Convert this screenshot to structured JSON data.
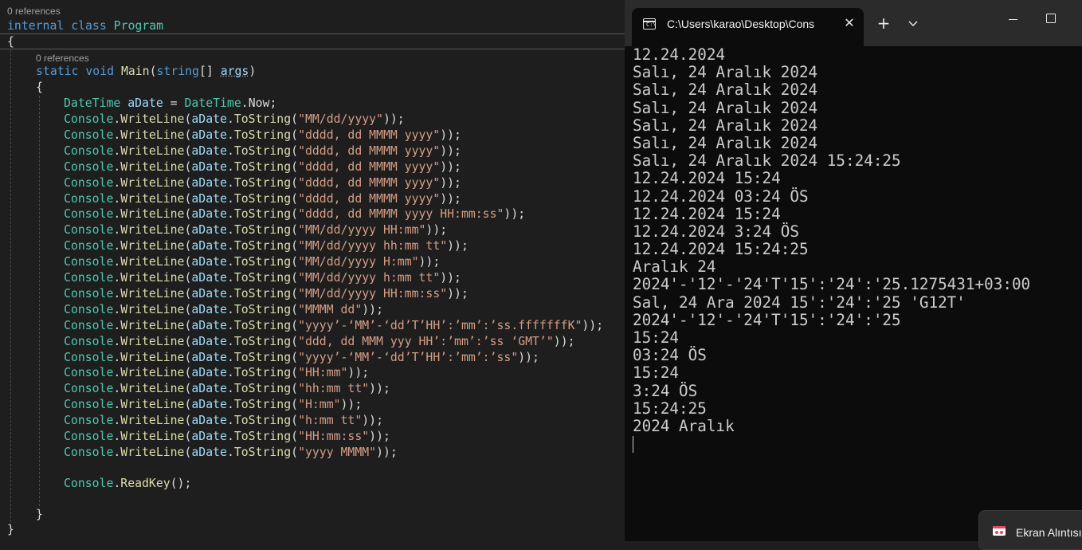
{
  "editor": {
    "class_refs": "0 references",
    "method_refs": "0 references",
    "class_decl": {
      "kw1": "internal",
      "kw2": "class",
      "name": "Program"
    },
    "open_brace": "{",
    "close_brace": "}",
    "main_sig": {
      "kw1": "static",
      "kw2": "void",
      "name": "Main",
      "p1": "(",
      "ptype": "string",
      "p2": "[] ",
      "param": "args",
      "p3": ")"
    },
    "method_open": "{",
    "method_close": "}",
    "decl_line": {
      "type": "DateTime",
      "var": "aDate",
      "eq": " = ",
      "type2": "DateTime",
      "dot": ".",
      "prop": "Now",
      "semi": ";"
    },
    "write_prefix": {
      "cls": "Console",
      "dot1": ".",
      "method": "WriteLine",
      "op1": "(",
      "var": "aDate",
      "dot2": ".",
      "method2": "ToString",
      "op2": "("
    },
    "write_suffix": "));",
    "format_strings": [
      "\"MM/dd/yyyy\"",
      "\"dddd, dd MMMM yyyy\"",
      "\"dddd, dd MMMM yyyy\"",
      "\"dddd, dd MMMM yyyy\"",
      "\"dddd, dd MMMM yyyy\"",
      "\"dddd, dd MMMM yyyy\"",
      "\"dddd, dd MMMM yyyy HH:mm:ss\"",
      "\"MM/dd/yyyy HH:mm\"",
      "\"MM/dd/yyyy hh:mm tt\"",
      "\"MM/dd/yyyy H:mm\"",
      "\"MM/dd/yyyy h:mm tt\"",
      "\"MM/dd/yyyy HH:mm:ss\"",
      "\"MMMM dd\"",
      "\"yyyy’-‘MM’-‘dd’T’HH’:’mm’:’ss.fffffffK\"",
      "\"ddd, dd MMM yyy HH’:’mm’:’ss ‘GMT’\"",
      "\"yyyy’-‘MM’-‘dd’T’HH’:’mm’:’ss\"",
      "\"HH:mm\"",
      "\"hh:mm tt\"",
      "\"H:mm\"",
      "\"h:mm tt\"",
      "\"HH:mm:ss\"",
      "\"yyyy MMMM\""
    ],
    "readkey_line": {
      "cls": "Console",
      "dot": ".",
      "method": "ReadKey",
      "rest": "();"
    }
  },
  "terminal": {
    "tab_title": "C:\\Users\\karao\\Desktop\\Cons",
    "tab_icon_glyph": "C:\\",
    "close_glyph": "✕",
    "new_tab_glyph": "+",
    "output": [
      "12.24.2024",
      "Salı, 24 Aralık 2024",
      "Salı, 24 Aralık 2024",
      "Salı, 24 Aralık 2024",
      "Salı, 24 Aralık 2024",
      "Salı, 24 Aralık 2024",
      "Salı, 24 Aralık 2024 15:24:25",
      "12.24.2024 15:24",
      "12.24.2024 03:24 ÖS",
      "12.24.2024 15:24",
      "12.24.2024 3:24 ÖS",
      "12.24.2024 15:24:25",
      "Aralık 24",
      "2024'-'12'-'24'T'15':'24':'25.1275431+03:00",
      "Sal, 24 Ara 2024 15':'24':'25 'G12T'",
      "2024'-'12'-'24'T'15':'24':'25",
      "15:24",
      "03:24 ÖS",
      "15:24",
      "3:24 ÖS",
      "15:24:25",
      "2024 Aralık"
    ]
  },
  "toast": {
    "label": "Ekran Alıntısı"
  },
  "colors": {
    "keyword": "#569cd6",
    "type": "#4ec9b0",
    "method": "#dcdcaa",
    "variable": "#9cdcfe",
    "string": "#d69d85",
    "editor_bg": "#1e1e1e",
    "terminal_bg": "#0c0c0c"
  }
}
